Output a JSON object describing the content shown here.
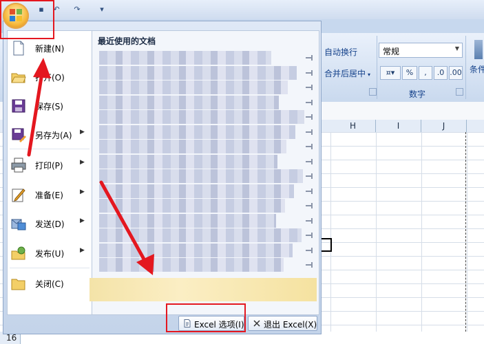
{
  "ribbon": {
    "wrap_text": "自动换行",
    "merge_center": "合并后居中",
    "number_format": "常规",
    "number_group_label": "数字",
    "conditional_format": "条件",
    "percent": "%",
    "comma": ","
  },
  "sheet": {
    "columns": [
      "H",
      "I",
      "J"
    ],
    "row_number": "16"
  },
  "office_menu": {
    "items": [
      {
        "label": "新建(N)",
        "icon": "new-document-icon",
        "has_submenu": false
      },
      {
        "label": "打开(O)",
        "icon": "open-folder-icon",
        "has_submenu": false
      },
      {
        "label": "保存(S)",
        "icon": "save-icon",
        "has_submenu": false
      },
      {
        "label": "另存为(A)",
        "icon": "save-as-icon",
        "has_submenu": true
      },
      {
        "label": "打印(P)",
        "icon": "printer-icon",
        "has_submenu": true
      },
      {
        "label": "准备(E)",
        "icon": "prepare-icon",
        "has_submenu": true
      },
      {
        "label": "发送(D)",
        "icon": "send-icon",
        "has_submenu": true
      },
      {
        "label": "发布(U)",
        "icon": "publish-icon",
        "has_submenu": true
      },
      {
        "label": "关闭(C)",
        "icon": "close-folder-icon",
        "has_submenu": false
      }
    ],
    "recent_title": "最近使用的文档",
    "excel_options": "Excel 选项(I)",
    "exit_excel": "退出 Excel(X)"
  },
  "colors": {
    "annotation_red": "#e4171f",
    "office_orange": "#f7b93b",
    "ribbon_blue": "#15428b"
  }
}
